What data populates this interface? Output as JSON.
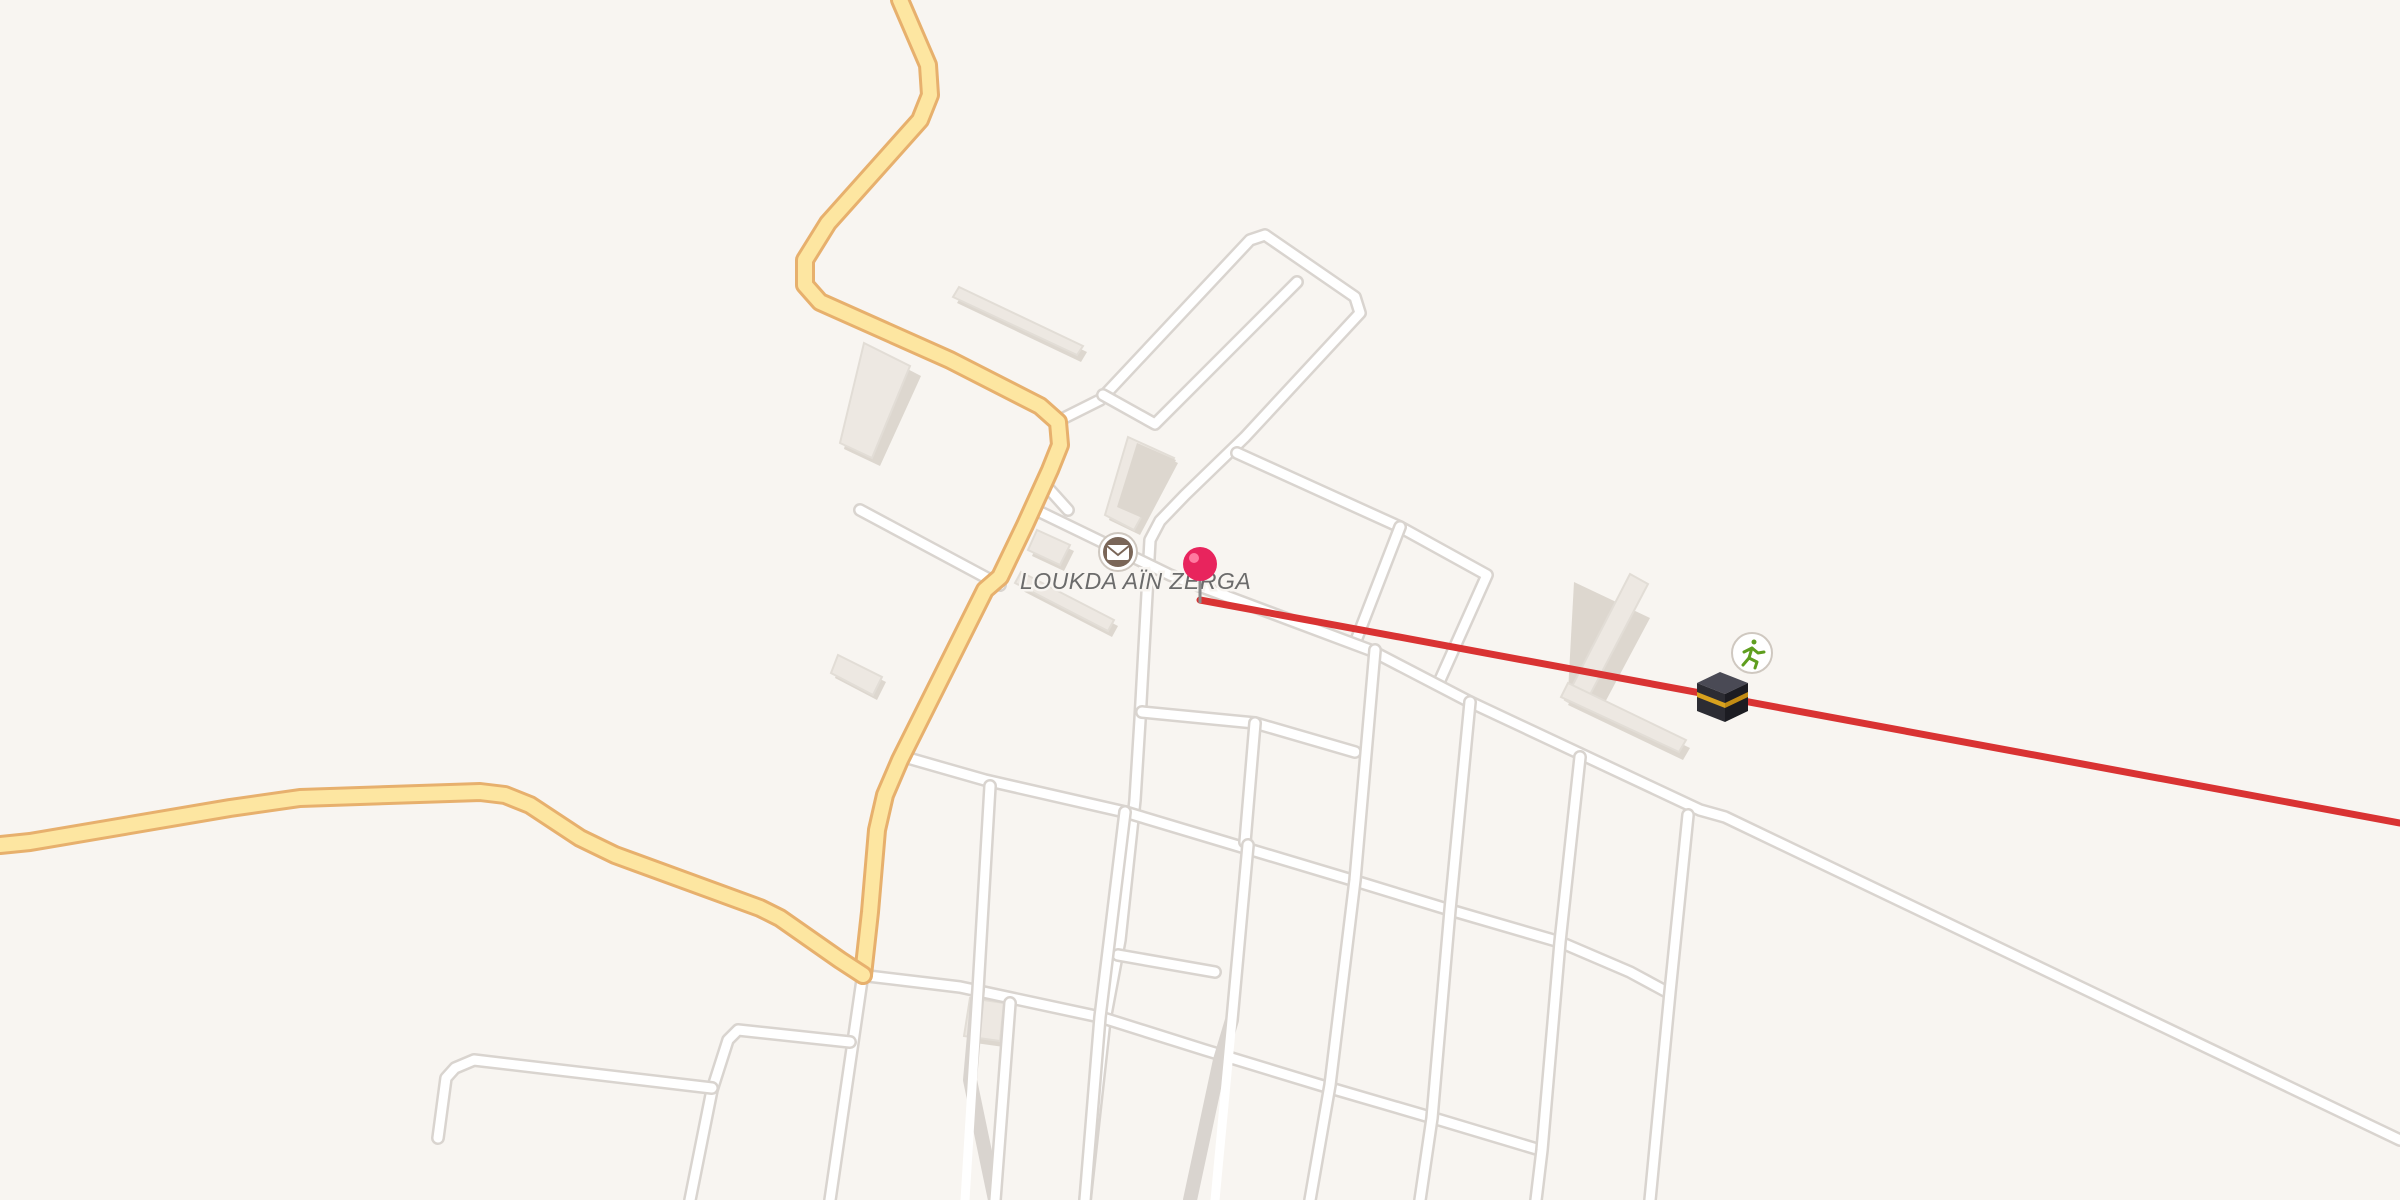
{
  "map": {
    "place_label": "LOUKDA AÏN ZERGA",
    "colors": {
      "background": "#f8f5f1",
      "minor_road": "#ffffff",
      "main_road": "#fde6a1",
      "main_road_casing": "#e7b06d",
      "route_line": "#d93333",
      "pin": "#e8245d"
    },
    "markers": [
      {
        "name": "location-pin",
        "icon": "pin-icon"
      },
      {
        "name": "post-office",
        "icon": "envelope-icon"
      },
      {
        "name": "kaaba-qibla",
        "icon": "kaaba-icon"
      },
      {
        "name": "sports-poi",
        "icon": "running-person-icon"
      }
    ]
  }
}
